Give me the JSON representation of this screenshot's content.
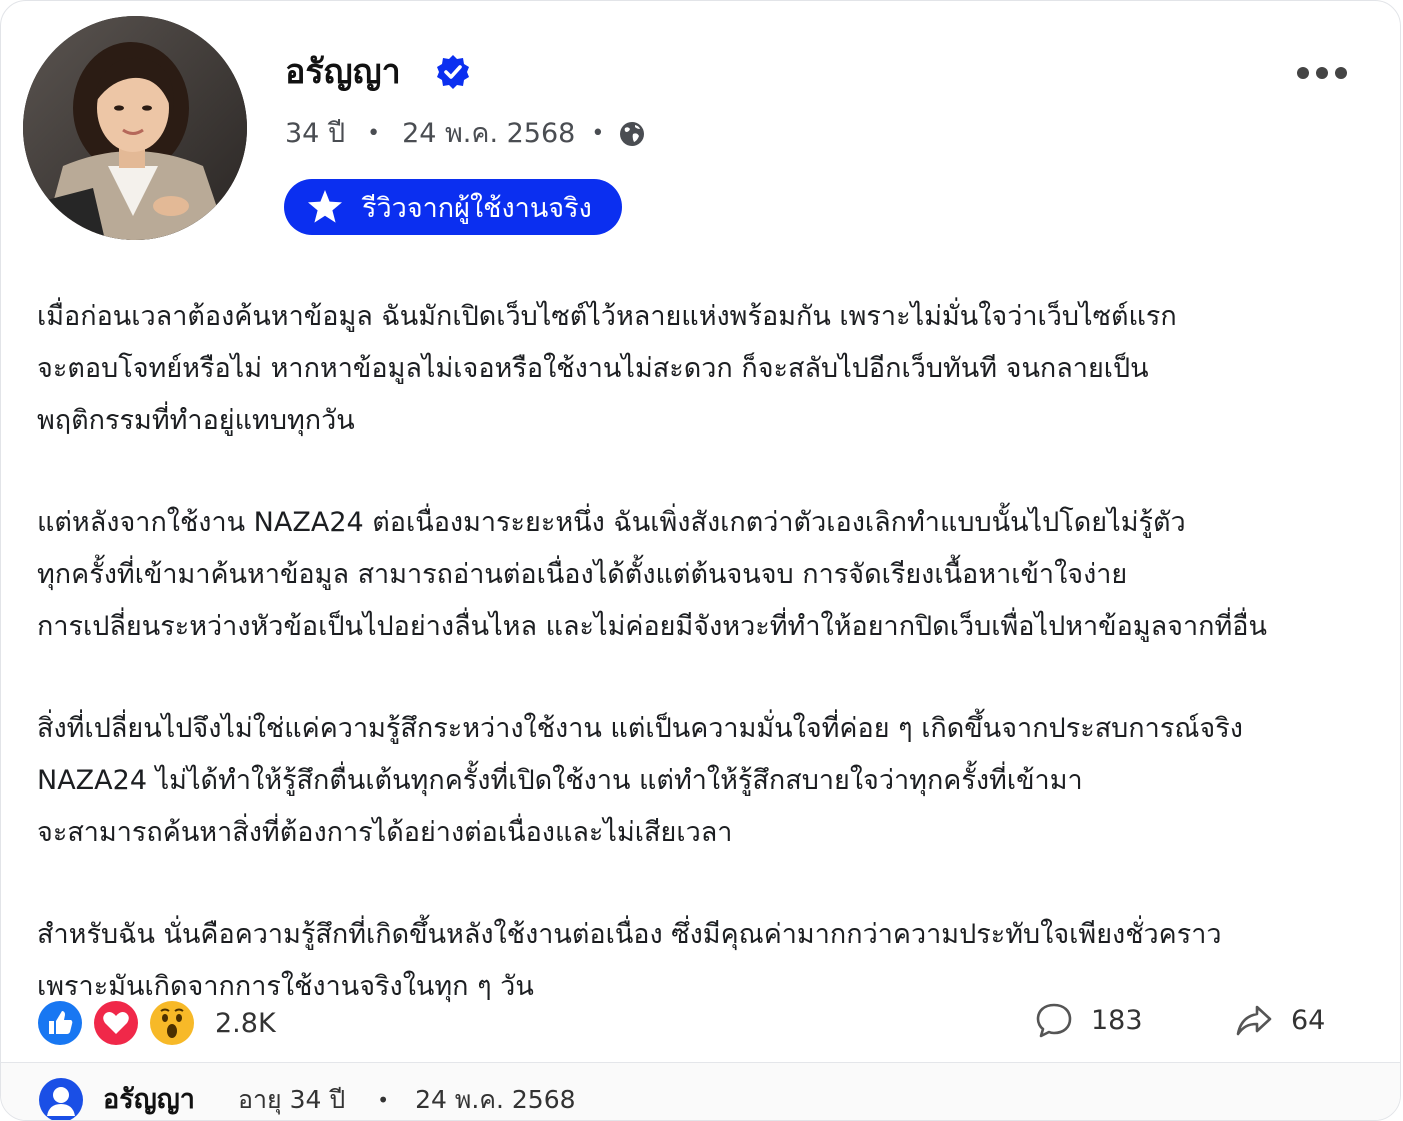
{
  "post": {
    "author_name": "อรัญญา",
    "age": "34 ปี",
    "date": "24 พ.ค. 2568",
    "badge_label": "รีวิวจากผู้ใช้งานจริง",
    "paragraphs": [
      [
        "เมื่อก่อนเวลาต้องค้นหาข้อมูล ฉันมักเปิดเว็บไซต์ไว้หลายแห่งพร้อมกัน เพราะไม่มั่นใจว่าเว็บไซต์แรก",
        "จะตอบโจทย์หรือไม่ หากหาข้อมูลไม่เจอหรือใช้งานไม่สะดวก ก็จะสลับไปอีกเว็บทันที จนกลายเป็น",
        "พฤติกรรมที่ทำอยู่แทบทุกวัน"
      ],
      [
        "แต่หลังจากใช้งาน NAZA24 ต่อเนื่องมาระยะหนึ่ง ฉันเพิ่งสังเกตว่าตัวเองเลิกทำแบบนั้นไปโดยไม่รู้ตัว",
        "ทุกครั้งที่เข้ามาค้นหาข้อมูล สามารถอ่านต่อเนื่องได้ตั้งแต่ต้นจนจบ การจัดเรียงเนื้อหาเข้าใจง่าย",
        "การเปลี่ยนระหว่างหัวข้อเป็นไปอย่างลื่นไหล และไม่ค่อยมีจังหวะที่ทำให้อยากปิดเว็บเพื่อไปหาข้อมูลจากที่อื่น"
      ],
      [
        "สิ่งที่เปลี่ยนไปจึงไม่ใช่แค่ความรู้สึกระหว่างใช้งาน แต่เป็นความมั่นใจที่ค่อย ๆ เกิดขึ้นจากประสบการณ์จริง",
        "NAZA24 ไม่ได้ทำให้รู้สึกตื่นเต้นทุกครั้งที่เปิดใช้งาน แต่ทำให้รู้สึกสบายใจว่าทุกครั้งที่เข้ามา",
        "จะสามารถค้นหาสิ่งที่ต้องการได้อย่างต่อเนื่องและไม่เสียเวลา"
      ],
      [
        "สำหรับฉัน นั่นคือความรู้สึกที่เกิดขึ้นหลังใช้งานต่อเนื่อง ซึ่งมีคุณค่ามากกว่าความประทับใจเพียงชั่วคราว",
        "เพราะมันเกิดจากการใช้งานจริงในทุก ๆ วัน"
      ]
    ]
  },
  "stats": {
    "reaction_count": "2.8K",
    "comment_count": "183",
    "share_count": "64"
  },
  "footer": {
    "name": "อรัญญา",
    "age": "อายุ 34 ปี",
    "date": "24 พ.ค. 2568"
  },
  "colors": {
    "accent": "#0b2ff0",
    "like": "#1877f2",
    "love": "#f02849",
    "wow": "#f7b928"
  }
}
